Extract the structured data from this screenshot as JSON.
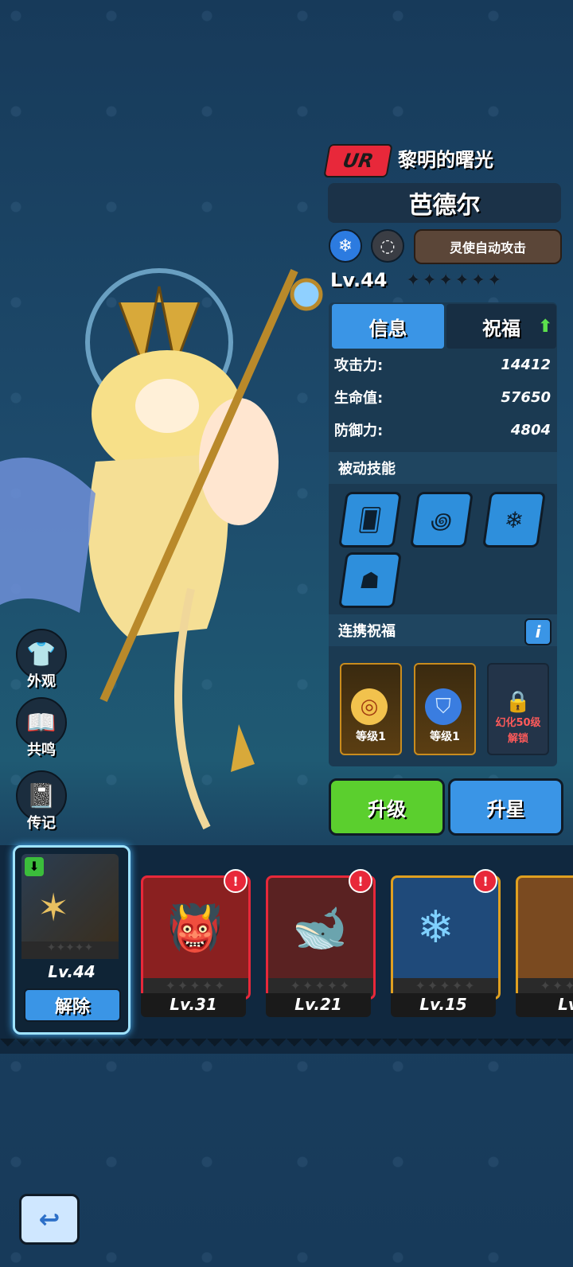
{
  "header": {
    "rarity": "UR",
    "title": "黎明的曙光",
    "name": "芭德尔",
    "auto_attack_label": "灵使自动攻击",
    "level": "Lv.44",
    "stars": "✦✦✦✦✦✦"
  },
  "tabs": {
    "info": "信息",
    "bless": "祝福"
  },
  "stats": [
    {
      "label": "攻击力:",
      "value": "14412"
    },
    {
      "label": "生命值:",
      "value": "57650"
    },
    {
      "label": "防御力:",
      "value": "4804"
    }
  ],
  "sections": {
    "passive": "被动技能",
    "link": "连携祝福"
  },
  "link_cards": [
    {
      "caption": "等级1"
    },
    {
      "caption": "等级1"
    }
  ],
  "locked_card": {
    "line1": "幻化50级",
    "line2": "解锁"
  },
  "buttons": {
    "upgrade": "升级",
    "star_up": "升星"
  },
  "side_menu": [
    {
      "label": "外观",
      "icon": "shirt-icon"
    },
    {
      "label": "共鸣",
      "icon": "book-icon"
    },
    {
      "label": "传记",
      "icon": "journal-icon"
    }
  ],
  "pets": {
    "selected": {
      "level": "Lv.44",
      "remove_label": "解除"
    },
    "others": [
      {
        "level": "Lv.31",
        "color": "#e8283a"
      },
      {
        "level": "Lv.21",
        "color": "#e8283a"
      },
      {
        "level": "Lv.15",
        "color": "#e0a020"
      },
      {
        "level": "Lv",
        "color": "#e0a020"
      }
    ]
  },
  "colors": {
    "accent_blue": "#3a95e6",
    "accent_green": "#5bcf2e",
    "rarity_red": "#e8283a"
  }
}
